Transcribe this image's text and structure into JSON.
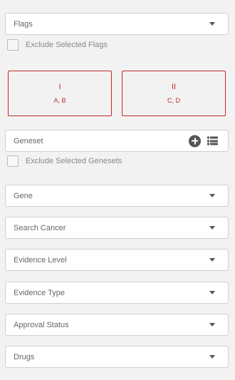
{
  "filters": {
    "flags": {
      "label": "Flags"
    },
    "exclude_flags": {
      "label": "Exclude Selected Flags"
    },
    "cards": [
      {
        "title": "I",
        "sub": "A, B"
      },
      {
        "title": "II",
        "sub": "C, D"
      }
    ],
    "geneset": {
      "label": "Geneset",
      "icons": [
        "plus-circle-icon",
        "list-icon"
      ]
    },
    "exclude_genesets": {
      "label": "Exclude Selected Genesets"
    },
    "gene": {
      "label": "Gene"
    },
    "cancer": {
      "label": "Search Cancer"
    },
    "evidence_level": {
      "label": "Evidence Level"
    },
    "evidence_type": {
      "label": "Evidence Type"
    },
    "approval_status": {
      "label": "Approval Status"
    },
    "drugs": {
      "label": "Drugs"
    }
  },
  "colors": {
    "accent": "#c62828",
    "background": "#f2f2f2"
  }
}
